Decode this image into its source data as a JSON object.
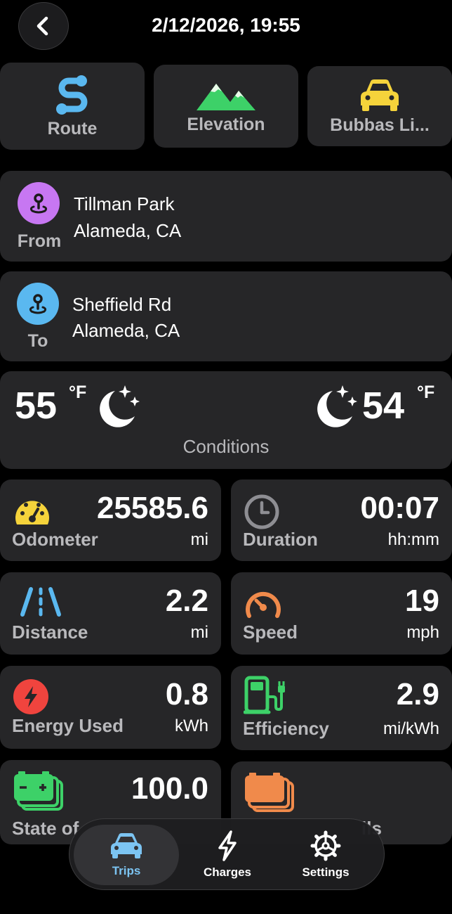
{
  "header": {
    "title": "2/12/2026, 19:55"
  },
  "tiles": [
    {
      "label": "Route",
      "icon": "route-icon"
    },
    {
      "label": "Elevation",
      "icon": "mountains-icon"
    },
    {
      "label": "Bubbas Li...",
      "icon": "car-icon"
    }
  ],
  "from": {
    "tag": "From",
    "line1": "Tillman Park",
    "line2": "Alameda, CA"
  },
  "to": {
    "tag": "To",
    "line1": "Sheffield Rd",
    "line2": "Alameda, CA"
  },
  "conditions": {
    "label": "Conditions",
    "start_temp": "55",
    "end_temp": "54",
    "unit": "°F"
  },
  "stats": {
    "odometer": {
      "label": "Odometer",
      "value": "25585.6",
      "unit": "mi"
    },
    "duration": {
      "label": "Duration",
      "value": "00:07",
      "unit": "hh:mm"
    },
    "distance": {
      "label": "Distance",
      "value": "2.2",
      "unit": "mi"
    },
    "speed": {
      "label": "Speed",
      "value": "19",
      "unit": "mph"
    },
    "energy": {
      "label": "Energy Used",
      "value": "0.8",
      "unit": "kWh"
    },
    "efficiency": {
      "label": "Efficiency",
      "value": "2.9",
      "unit": "mi/kWh"
    },
    "soc": {
      "label": "State of",
      "value": "100.0"
    },
    "battery2": {
      "label": "ils"
    }
  },
  "tabs": [
    {
      "label": "Trips"
    },
    {
      "label": "Charges"
    },
    {
      "label": "Settings"
    }
  ],
  "colors": {
    "accent_blue": "#5ab8f0",
    "green": "#3dd168",
    "yellow": "#f5d33b",
    "purple": "#c777f2",
    "orange": "#f08a4b",
    "red": "#f0443e"
  }
}
